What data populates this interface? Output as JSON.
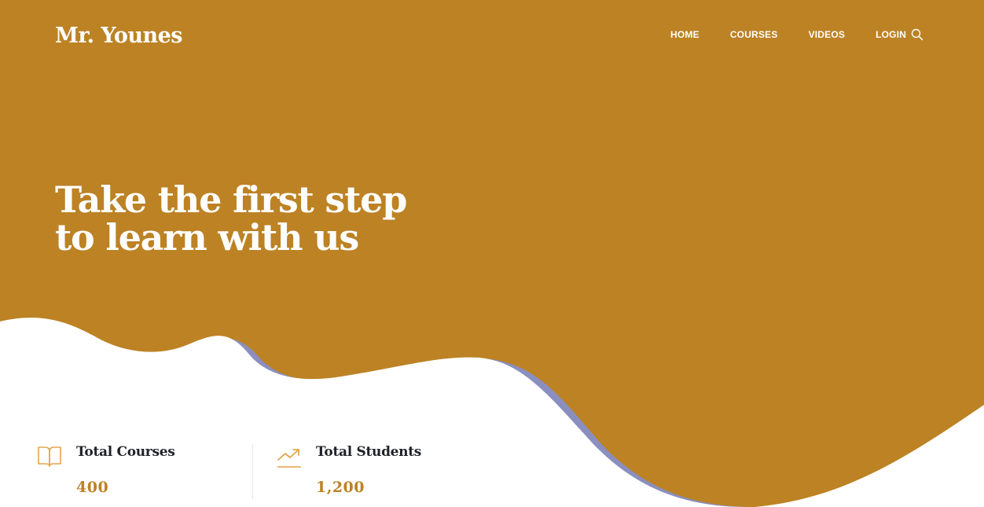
{
  "colors": {
    "brand": "#bc8224",
    "wave_shadow": "#8a8fc0",
    "heading_dark": "#1f2228",
    "icon_gold": "#e2a54a"
  },
  "header": {
    "logo": "Mr. Younes",
    "nav": [
      "HOME",
      "COURSES",
      "VIDEOS",
      "LOGIN"
    ],
    "search_icon": "search-icon"
  },
  "hero": {
    "headline_line1": "Take the first step",
    "headline_line2": "to learn with us"
  },
  "stats": [
    {
      "icon": "book-open-icon",
      "title": "Total Courses",
      "value": "400"
    },
    {
      "icon": "trending-up-icon",
      "title": "Total Students",
      "value": "1,200"
    }
  ]
}
